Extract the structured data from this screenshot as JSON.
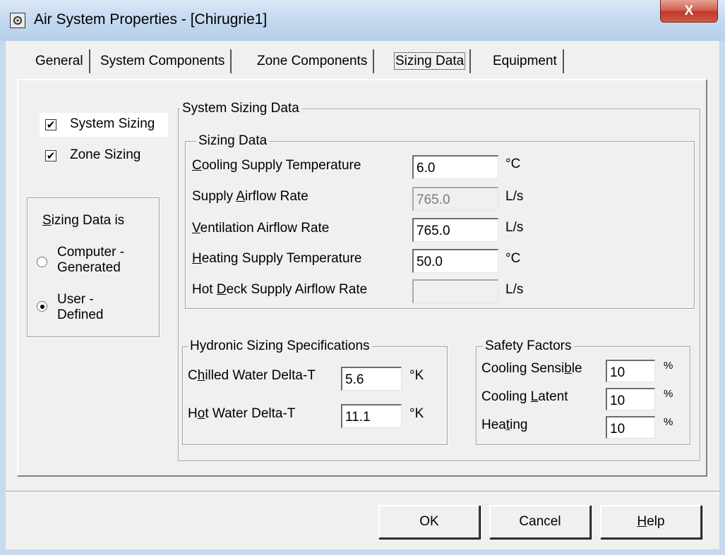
{
  "window": {
    "title": "Air System Properties - [Chirugrie1]",
    "close_glyph": "X",
    "app_icon": "gear-icon"
  },
  "tabs": [
    {
      "label": "General"
    },
    {
      "label": "System Components"
    },
    {
      "label": "Zone Components"
    },
    {
      "label": "Sizing Data",
      "active": true
    },
    {
      "label": "Equipment"
    }
  ],
  "sizing_options": {
    "system_sizing": {
      "label": "System Sizing",
      "checked": true
    },
    "zone_sizing": {
      "label": "Zone Sizing",
      "checked": true
    }
  },
  "sizing_data_is": {
    "title_prefix": "S",
    "title_rest": "izing Data is",
    "options": [
      {
        "line1": "Computer -",
        "line2": "Generated",
        "selected": false
      },
      {
        "line1": "User -",
        "line2": "Defined",
        "selected": true
      }
    ]
  },
  "system_sizing_data": {
    "title": "System Sizing Data",
    "sizing_data": {
      "title": "Sizing Data",
      "rows": [
        {
          "pre": "",
          "key": "C",
          "post": "ooling Supply Temperature",
          "value": "6.0",
          "unit": "°C",
          "disabled": false
        },
        {
          "pre": "Supply ",
          "key": "A",
          "post": "irflow Rate",
          "value": "765.0",
          "unit": "L/s",
          "disabled": true
        },
        {
          "pre": "",
          "key": "V",
          "post": "entilation Airflow Rate",
          "value": "765.0",
          "unit": "L/s",
          "disabled": false
        },
        {
          "pre": "",
          "key": "H",
          "post": "eating Supply Temperature",
          "value": "50.0",
          "unit": "°C",
          "disabled": false
        },
        {
          "pre": "Hot ",
          "key": "D",
          "post": "eck Supply Airflow Rate",
          "value": "",
          "unit": "L/s",
          "disabled": true
        }
      ]
    },
    "hydronic": {
      "title": "Hydronic Sizing Specifications",
      "rows": [
        {
          "pre": "C",
          "key": "h",
          "post": "illed Water Delta-T",
          "value": "5.6",
          "unit": "°K"
        },
        {
          "pre": "H",
          "key": "o",
          "post": "t Water Delta-T",
          "value": "11.1",
          "unit": "°K"
        }
      ]
    },
    "safety_factors": {
      "title": "Safety Factors",
      "rows": [
        {
          "pre": "Cooling Sensi",
          "key": "b",
          "post": "le",
          "value": "10",
          "unit": "%"
        },
        {
          "pre": "Cooling ",
          "key": "L",
          "post": "atent",
          "value": "10",
          "unit": "%"
        },
        {
          "pre": "Hea",
          "key": "t",
          "post": "ing",
          "value": "10",
          "unit": "%"
        }
      ]
    }
  },
  "buttons": {
    "ok": "OK",
    "cancel": "Cancel",
    "help_key": "H",
    "help_rest": "elp"
  }
}
